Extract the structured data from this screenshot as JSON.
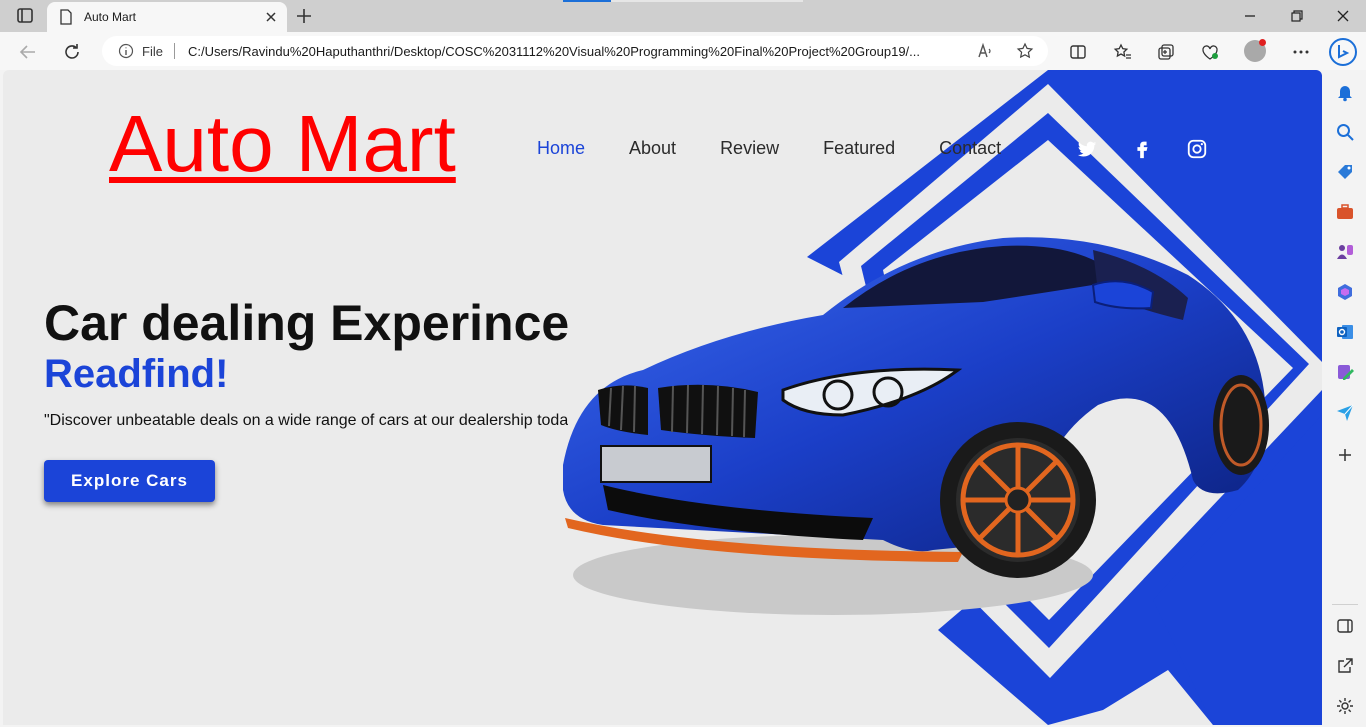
{
  "browser": {
    "tab_title": "Auto Mart",
    "address_file_label": "File",
    "address_url": "C:/Users/Ravindu%20Haputhanthri/Desktop/COSC%2031112%20Visual%20Programming%20Final%20Project%20Group19/...",
    "accent_color": "#1b6fd8"
  },
  "site": {
    "logo": "Auto Mart",
    "nav": [
      "Home",
      "About",
      "Review",
      "Featured",
      "Contact"
    ],
    "active_nav": "Home",
    "social_icons": [
      "twitter-icon",
      "facebook-icon",
      "instagram-icon"
    ]
  },
  "hero": {
    "headline": "Car dealing Experince",
    "subheadline": "Readfind!",
    "tagline": "\"Discover unbeatable deals on a wide range of cars at our dealership today",
    "cta_label": "Explore Cars"
  },
  "colors": {
    "brand_blue": "#1b44d8",
    "logo_red": "#ff0000",
    "page_bg": "#ebebeb"
  }
}
